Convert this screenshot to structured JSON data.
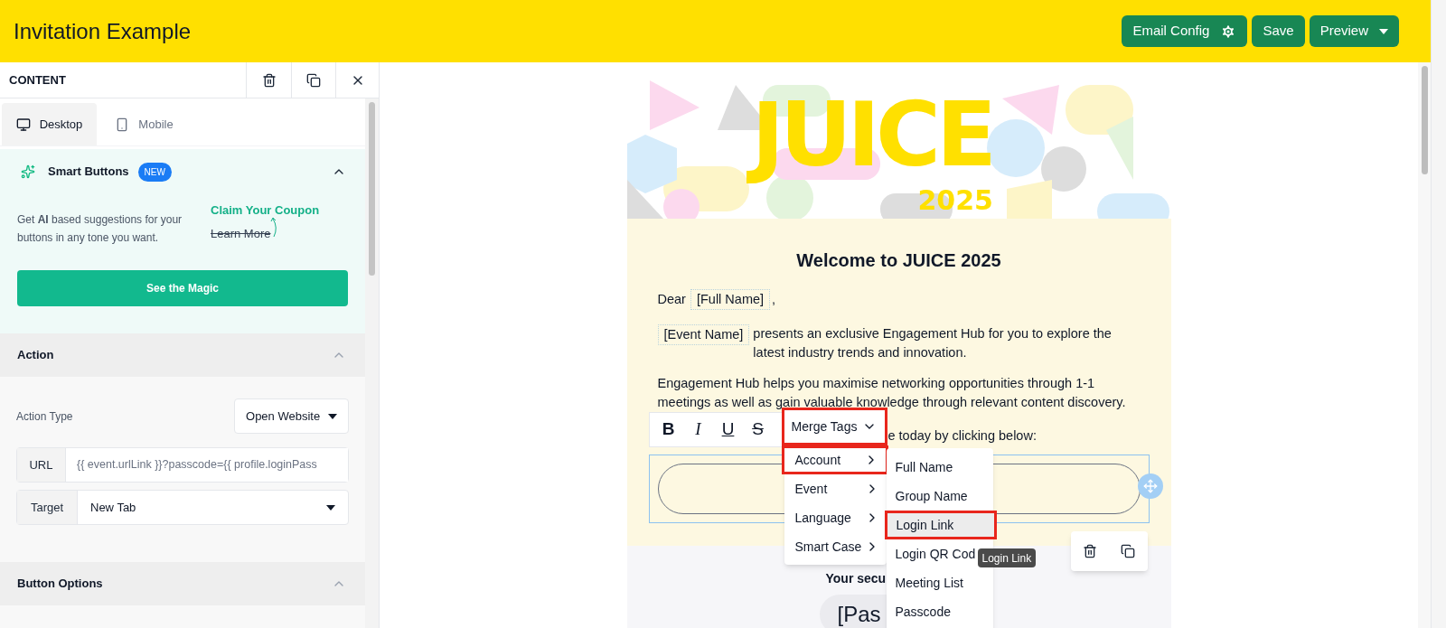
{
  "header": {
    "title": "Invitation Example",
    "buttons": [
      {
        "label": "Email Config",
        "kind": "config"
      },
      {
        "label": "Save",
        "kind": "plain"
      },
      {
        "label": "Preview",
        "kind": "dropdown"
      }
    ]
  },
  "panel": {
    "title": "CONTENT",
    "tabs": [
      {
        "label": "Desktop",
        "kind": "desktop",
        "selected": true
      },
      {
        "label": "Mobile",
        "kind": "mobile",
        "selected": false
      }
    ],
    "smart_buttons": {
      "title": "Smart Buttons",
      "badge": "NEW",
      "expanded": true,
      "description": "Get **AI** based suggestions for your buttons in any tone you want.",
      "sample_primary": "Claim Your Coupon",
      "sample_struck": "Learn More",
      "button": "See the Magic"
    },
    "action": {
      "title": "Action",
      "expanded": true,
      "type_label": "Action Type",
      "type_value": "Open Website",
      "url_label": "URL",
      "url_value": "{{ event.urlLink }}?passcode={{ profile.loginPass",
      "target_label": "Target",
      "target_value": "New Tab"
    },
    "button_options": {
      "title": "Button Options",
      "expanded": true
    }
  },
  "email": {
    "logo": {
      "word": "JUICE",
      "year": "2025"
    },
    "heading": "Welcome to JUICE 2025",
    "greeting": {
      "before": "Dear",
      "tag": "[Full Name]",
      "after": ","
    },
    "intro": {
      "tag": "[Event Name]",
      "text": "presents an exclusive Engagement Hub for you to explore the latest industry trends and innovation."
    },
    "body": "Engagement Hub helps you maximise networking opportunities through 1-1 meetings as well as gain valuable knowledge through relevant content discovery.",
    "cta_text": "e today by clicking below:",
    "secure_text": "Your secu",
    "passcode": "[Pas"
  },
  "toolbar": {
    "formats": [
      {
        "kind": "bold",
        "label": "B"
      },
      {
        "kind": "italic",
        "label": "I"
      },
      {
        "kind": "underline",
        "label": "U"
      },
      {
        "kind": "strike",
        "label": "S"
      }
    ],
    "merge_tags": {
      "label": "Merge Tags",
      "highlighted": true
    }
  },
  "merge_menu": [
    {
      "label": "Account",
      "highlighted": true
    },
    {
      "label": "Event",
      "highlighted": false
    },
    {
      "label": "Language",
      "highlighted": false
    },
    {
      "label": "Smart Case",
      "highlighted": false
    }
  ],
  "submenu": [
    {
      "label": "Full Name",
      "selected": false,
      "highlighted": false
    },
    {
      "label": "Group Name",
      "selected": false,
      "highlighted": false
    },
    {
      "label": "Login Link",
      "selected": true,
      "highlighted": true
    },
    {
      "label": "Login QR Cod",
      "selected": false,
      "highlighted": false
    },
    {
      "label": "Meeting List",
      "selected": false,
      "highlighted": false
    },
    {
      "label": "Passcode",
      "selected": false,
      "highlighted": false
    }
  ],
  "tooltip": "Login Link"
}
